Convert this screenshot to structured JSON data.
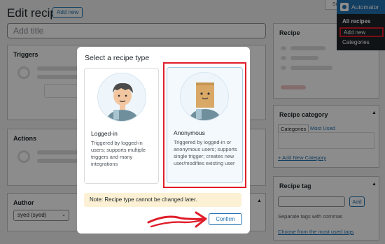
{
  "page": {
    "title": "Edit recipe",
    "add_new_label": "Add new",
    "screen_options_label": "Sc",
    "title_placeholder": "Add title"
  },
  "boxes": {
    "triggers": "Triggers",
    "actions": "Actions",
    "author": "Author",
    "author_value": "syed (syed)"
  },
  "sidebar": {
    "recipe": "Recipe",
    "recipe_category": "Recipe category",
    "tab_categories": "Categories",
    "tab_most_used": "Most Used",
    "add_new_category": "+ Add New Category",
    "recipe_tag": "Recipe tag",
    "add_button": "Add",
    "separate_tags": "Separate tags with commas",
    "choose_tags": "Choose from the most used tags"
  },
  "admin_menu": {
    "header": "Automator",
    "items": [
      {
        "label": "All recipes"
      },
      {
        "label": "Add new"
      },
      {
        "label": "Categories"
      }
    ]
  },
  "modal": {
    "title": "Select a recipe type",
    "options": [
      {
        "title": "Logged-in",
        "description": "Triggered by logged-in users; supports multiple triggers and many integrations",
        "selected": false
      },
      {
        "title": "Anonymous",
        "description": "Triggered by logged-in or anonymous users; supports single trigger; creates new user/modifies existing user",
        "selected": true
      }
    ],
    "note": "Note: Recipe type cannot be changed later.",
    "confirm_label": "Confirm"
  },
  "colors": {
    "accent": "#2271b1",
    "highlight": "#e01d2a",
    "note_bg": "#fcf1d4"
  }
}
